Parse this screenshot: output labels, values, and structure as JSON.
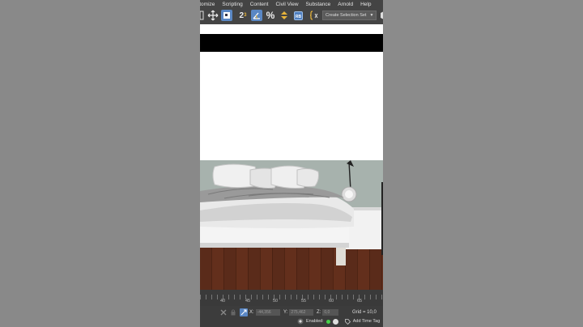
{
  "menubar": {
    "items": [
      "stomize",
      "Scripting",
      "Content",
      "Civil View",
      "Substance",
      "Arnold",
      "Help"
    ]
  },
  "toolbar": {
    "buttons": [
      {
        "icon": "select-region-icon"
      },
      {
        "icon": "move-icon"
      },
      {
        "icon": "select-object-icon"
      },
      {
        "icon": "snap-toggle-icon",
        "label": "2"
      },
      {
        "icon": "angle-snap-icon"
      },
      {
        "icon": "percent-snap-icon",
        "label": "%"
      },
      {
        "icon": "spinner-snap-icon"
      },
      {
        "icon": "named-selection-icon"
      },
      {
        "icon": "edit-named-sets-icon"
      }
    ],
    "selection_set_label": "Create Selection Set",
    "selection_set_arrow": "▼"
  },
  "timeline": {
    "ticks": [
      "40",
      "45",
      "50",
      "55",
      "60",
      "65"
    ]
  },
  "status": {
    "x_label": "X:",
    "x_value": "-44,356",
    "y_label": "Y:",
    "y_value": "275,462",
    "z_label": "Z:",
    "z_value": "0,0",
    "grid": "Grid = 10,0",
    "enabled_label": "Enabled:",
    "time_tag": "Add Time Tag"
  },
  "colors": {
    "accent": "#5a87c4",
    "wall": "#a7b2ad",
    "floor": "#5a2b1a",
    "enabled_dot": "#46d24a"
  }
}
